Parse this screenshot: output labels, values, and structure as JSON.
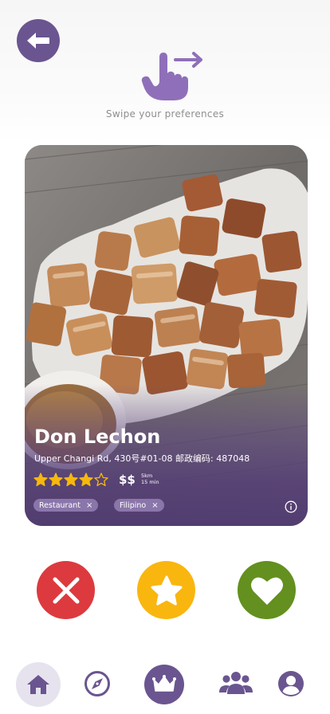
{
  "header": {
    "back_icon": "arrow-left-icon",
    "swipe_icon": "swipe-hand-icon",
    "swipe_text": "Swipe your preferences"
  },
  "card": {
    "name": "Don Lechon",
    "address": "Upper Changi Rd, 430号#01-08 邮政编码: 487048",
    "rating": 4,
    "rating_max": 5,
    "price": "$$",
    "distance": "5km",
    "time": "15 min",
    "tags": [
      "Restaurant",
      "Filipino"
    ],
    "tag_remove_symbol": "×",
    "info_icon": "info-icon"
  },
  "actions": {
    "dislike_icon": "close-icon",
    "superlike_icon": "star-icon",
    "like_icon": "heart-icon"
  },
  "bottom_nav": {
    "items": [
      "home-icon",
      "compass-icon",
      "crown-icon",
      "group-icon",
      "profile-icon"
    ],
    "active": "home-icon"
  },
  "colors": {
    "brand_purple": "#6a5590",
    "dislike_red": "#dc3a3f",
    "superlike_yellow": "#f9b60f",
    "like_green": "#63901e",
    "star_gold": "#f7b80e",
    "nav_active_bg": "#e6e3ee"
  }
}
